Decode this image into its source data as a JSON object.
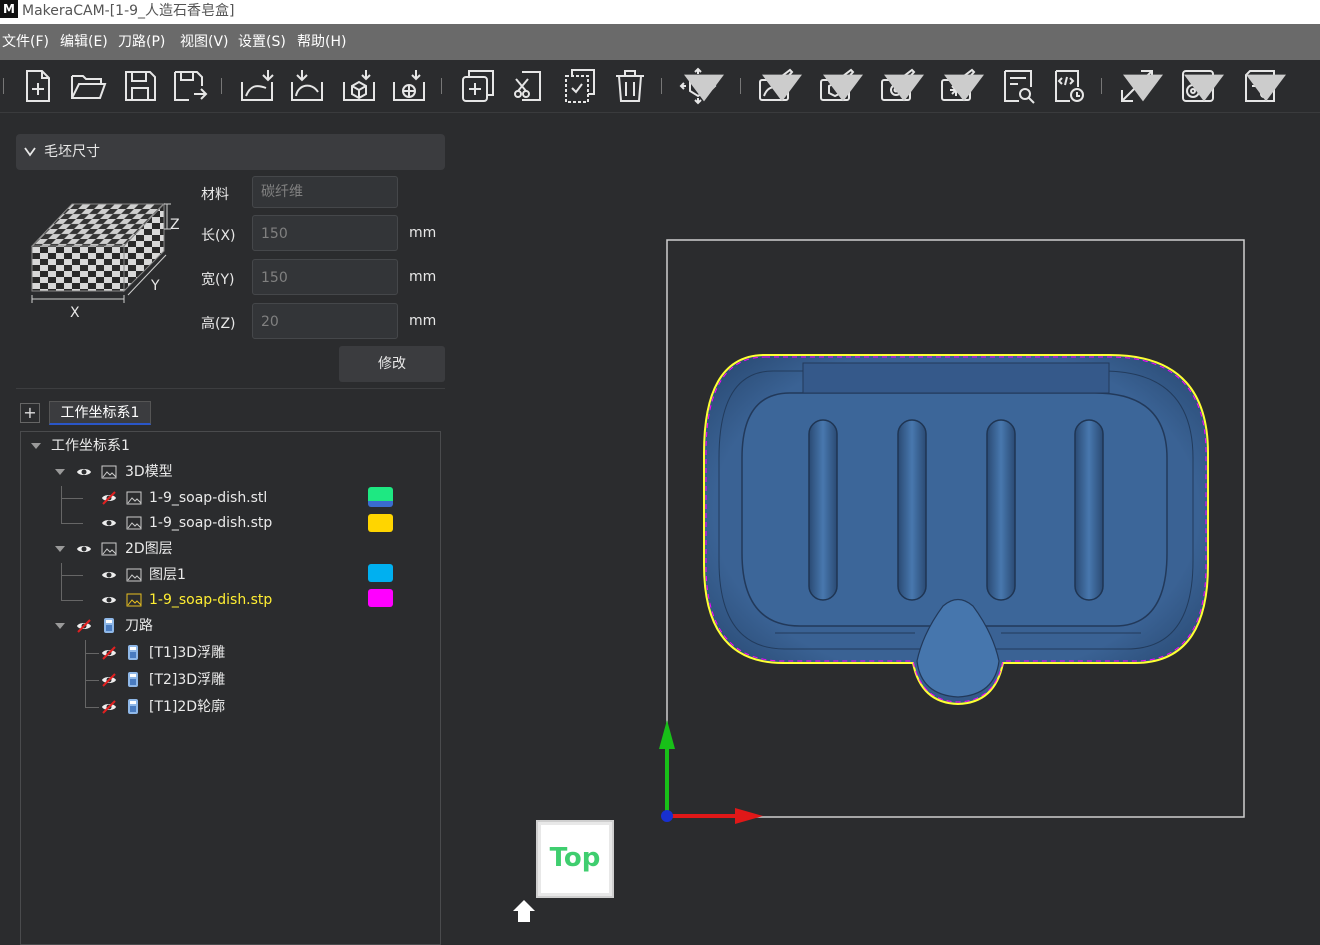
{
  "window": {
    "title": "MakeraCAM-[1-9_人造石香皂盒]",
    "logo_text": "M"
  },
  "menu": [
    "文件(F)",
    "编辑(E)",
    "刀路(P)",
    "视图(V)",
    "设置(S)",
    "帮助(H)"
  ],
  "toolbar": {
    "icons": [
      "new-file-icon",
      "open-folder-icon",
      "save-icon",
      "save-as-icon",
      "import-2d-icon",
      "import-curve-icon",
      "import-3d-model-icon",
      "import-mesh-icon",
      "add-coordinate-icon",
      "cut-icon",
      "copy-icon",
      "delete-icon",
      "transform-icon",
      "2d-contour-icon",
      "3d-roughing-icon",
      "drill-icon",
      "laser-icon",
      "preview-search-icon",
      "gcode-export-icon",
      "fullscreen-icon",
      "machine-connect-icon",
      "settings-file-icon"
    ]
  },
  "stock": {
    "header": "毛坯尺寸",
    "axis_x": "X",
    "axis_y": "Y",
    "axis_z": "Z",
    "material_label": "材料",
    "material_value": "碳纤维",
    "length_label": "长(X)",
    "length_value": "150",
    "width_label": "宽(Y)",
    "width_value": "150",
    "height_label": "高(Z)",
    "height_value": "20",
    "unit": "mm",
    "modify_button": "修改"
  },
  "coord_tab": {
    "add_label": "+",
    "tab_label": "工作坐标系1"
  },
  "tree": {
    "root": "工作坐标系1",
    "model_group": "3D模型",
    "model_items": [
      {
        "label": "1-9_soap-dish.stl",
        "color": "#1ee882",
        "visible": false
      },
      {
        "label": "1-9_soap-dish.stp",
        "color": "#ffd500",
        "visible": true
      }
    ],
    "layer_group": "2D图层",
    "layer_items": [
      {
        "label": "图层1",
        "color": "#00b0f0",
        "visible": true
      },
      {
        "label": "1-9_soap-dish.stp",
        "color": "#ff00ff",
        "visible": true,
        "highlight": true
      }
    ],
    "toolpath_group": "刀路",
    "toolpath_items": [
      "[T1]3D浮雕",
      "[T2]3D浮雕",
      "[T1]2D轮廓"
    ]
  },
  "viewport": {
    "view_label": "Top"
  },
  "colors": {
    "model_fill": "#3e6a9e",
    "outline_yellow": "#ffff33",
    "outline_magenta": "#ff00ff",
    "axis_x": "#e01818",
    "axis_y": "#18c018",
    "view_label": "#3fce6f"
  }
}
